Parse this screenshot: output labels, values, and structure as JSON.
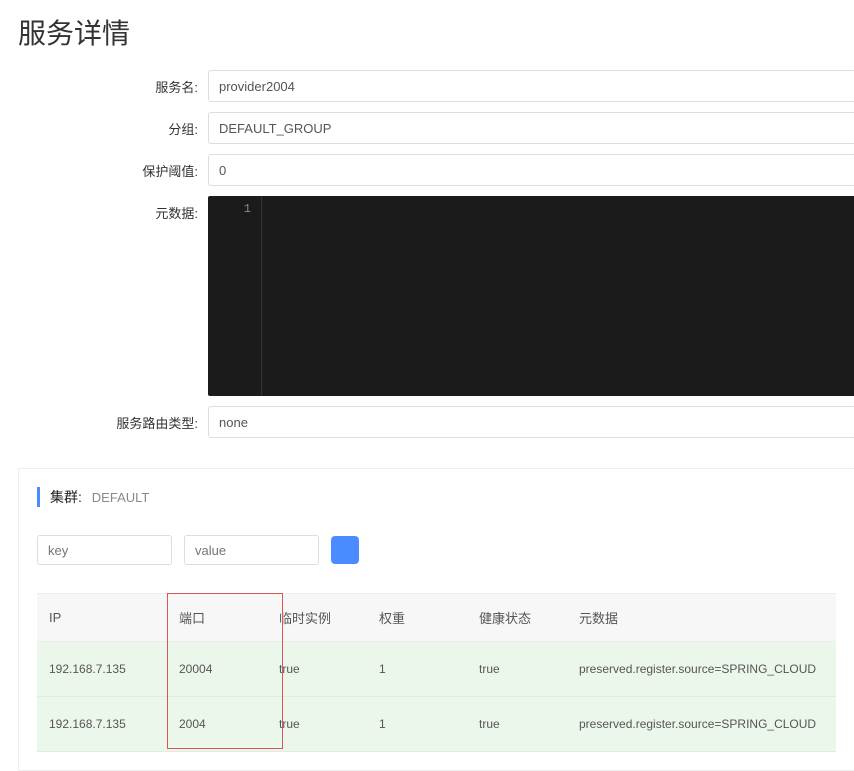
{
  "page_title": "服务详情",
  "form": {
    "service_name": {
      "label": "服务名:",
      "value": "provider2004"
    },
    "group": {
      "label": "分组:",
      "value": "DEFAULT_GROUP"
    },
    "protect_threshold": {
      "label": "保护阈值:",
      "value": "0"
    },
    "metadata": {
      "label": "元数据:",
      "line_number": "1",
      "value": ""
    },
    "route_type": {
      "label": "服务路由类型:",
      "value": "none"
    }
  },
  "cluster": {
    "label": "集群:",
    "name": "DEFAULT",
    "filter": {
      "key_placeholder": "key",
      "value_placeholder": "value"
    },
    "columns": {
      "ip": "IP",
      "port": "端口",
      "ephemeral": "临时实例",
      "weight": "权重",
      "health": "健康状态",
      "metadata": "元数据"
    },
    "rows": [
      {
        "ip": "192.168.7.135",
        "port": "20004",
        "ephemeral": "true",
        "weight": "1",
        "health": "true",
        "metadata": "preserved.register.source=SPRING_CLOUD"
      },
      {
        "ip": "192.168.7.135",
        "port": "2004",
        "ephemeral": "true",
        "weight": "1",
        "health": "true",
        "metadata": "preserved.register.source=SPRING_CLOUD"
      }
    ]
  }
}
